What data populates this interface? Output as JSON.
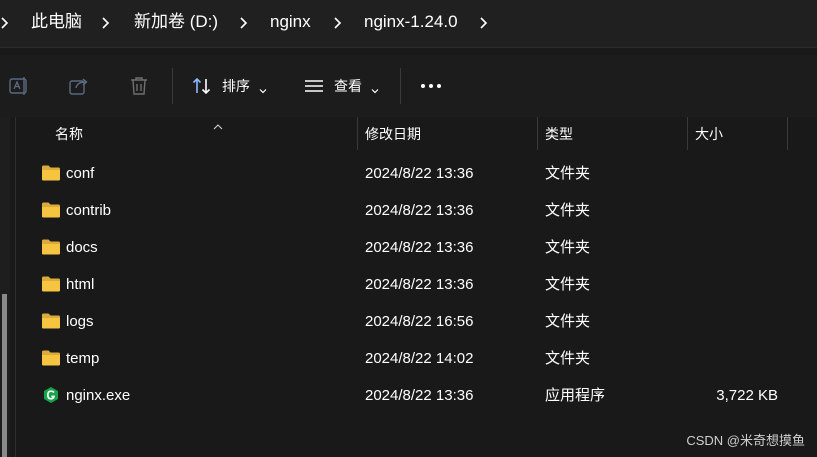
{
  "breadcrumb": {
    "items": [
      {
        "label": "此电脑"
      },
      {
        "label": "新加卷 (D:)"
      },
      {
        "label": "nginx"
      },
      {
        "label": "nginx-1.24.0"
      }
    ]
  },
  "toolbar": {
    "sort_label": "排序",
    "view_label": "查看"
  },
  "columns": {
    "name": "名称",
    "modified": "修改日期",
    "type": "类型",
    "size": "大小"
  },
  "files": [
    {
      "name": "conf",
      "modified": "2024/8/22 13:36",
      "type": "文件夹",
      "size": "",
      "icon": "folder-icon"
    },
    {
      "name": "contrib",
      "modified": "2024/8/22 13:36",
      "type": "文件夹",
      "size": "",
      "icon": "folder-icon"
    },
    {
      "name": "docs",
      "modified": "2024/8/22 13:36",
      "type": "文件夹",
      "size": "",
      "icon": "folder-icon"
    },
    {
      "name": "html",
      "modified": "2024/8/22 13:36",
      "type": "文件夹",
      "size": "",
      "icon": "folder-icon"
    },
    {
      "name": "logs",
      "modified": "2024/8/22 16:56",
      "type": "文件夹",
      "size": "",
      "icon": "folder-icon"
    },
    {
      "name": "temp",
      "modified": "2024/8/22 14:02",
      "type": "文件夹",
      "size": "",
      "icon": "folder-icon"
    },
    {
      "name": "nginx.exe",
      "modified": "2024/8/22 13:36",
      "type": "应用程序",
      "size": "3,722 KB",
      "icon": "nginx-exe-icon"
    }
  ],
  "watermark": "CSDN @米奇想摸鱼",
  "colors": {
    "background": "#191919",
    "folder": "#f5c542",
    "nginx_green": "#16a34a"
  }
}
